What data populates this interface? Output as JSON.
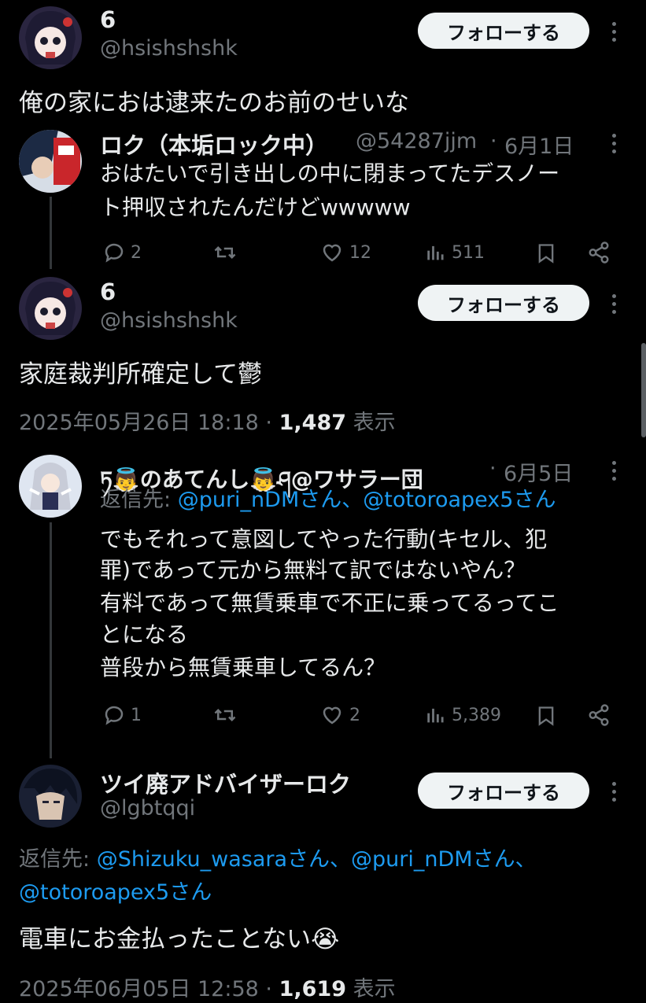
{
  "tweet1": {
    "name": "6",
    "handle": "@hsishshshk",
    "follow": "フォローする",
    "text": "俺の家におは逮来たのお前のせいな"
  },
  "quote1": {
    "name": "ロク（本垢ロック中）",
    "handle": "@54287jjm",
    "sep": "·",
    "date": "6月1日",
    "line1": "おはたいで引き出しの中に閉まってたデスノー",
    "line2": "ト押収されたんだけどwwwww",
    "replies": "2",
    "likes": "12",
    "views": "511"
  },
  "tweet2": {
    "name": "6",
    "handle": "@hsishshshk",
    "follow": "フォローする",
    "text": "家庭裁判所確定して鬱",
    "timestamp": "2025年05月26日 18:18",
    "sep": "·",
    "views": "1,487",
    "views_label": "表示"
  },
  "reply1": {
    "name_pre": "ཏ👼のあてんし👼ཤ@ワサラー団",
    "sep": "·",
    "date": "6月5日",
    "reply_to_label": "返信先:",
    "reply_to": "@puri_nDMさん、@totoroapex5さん",
    "lines": [
      "でもそれって意図してやった行動(キセル、犯",
      "罪)であって元から無料て訳ではないやん？",
      "有料であって無賃乗車で不正に乗ってるってこ",
      "とになる",
      "普段から無賃乗車してるん？"
    ],
    "replies": "1",
    "retweets": "",
    "likes": "2",
    "views": "5,389"
  },
  "tweet3": {
    "name": "ツイ廃アドバイザーロク",
    "handle": "@lgbtqqi",
    "follow": "フォローする",
    "reply_to_label": "返信先:",
    "reply_to_1": "@Shizuku_wasaraさん、@puri_nDMさん、",
    "reply_to_2": "@totoroapex5さん",
    "text": "電車にお金払ったことない😭",
    "timestamp": "2025年06月05日 12:58",
    "sep": "·",
    "views": "1,619",
    "views_label": "表示"
  }
}
